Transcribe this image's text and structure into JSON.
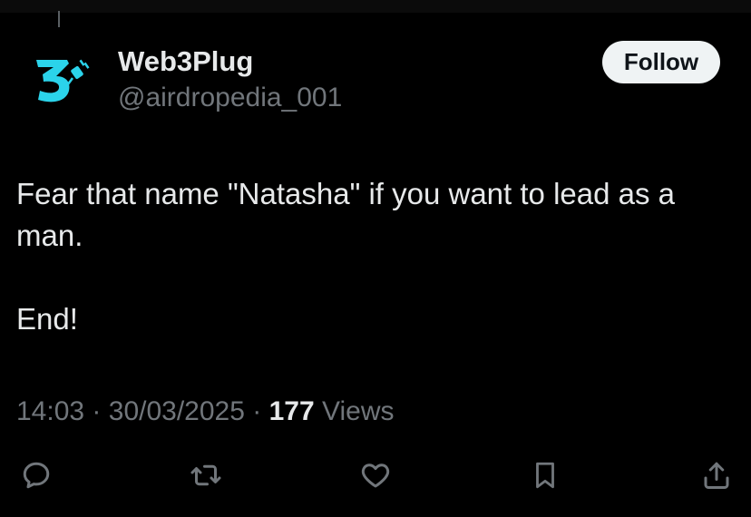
{
  "author": {
    "display_name": "Web3Plug",
    "handle": "@airdropedia_001",
    "avatar_icon": "web3plug-logo",
    "avatar_color": "#2bd3ea"
  },
  "follow_button": {
    "label": "Follow"
  },
  "tweet": {
    "lines": [
      "Fear that name \"Natasha\" if you want to lead as a man.",
      "End!"
    ]
  },
  "meta": {
    "time": "14:03",
    "separator": "·",
    "date": "30/03/2025",
    "views_count": "177",
    "views_label": "Views"
  },
  "actions": [
    {
      "name": "reply",
      "icon": "reply-icon"
    },
    {
      "name": "retweet",
      "icon": "retweet-icon"
    },
    {
      "name": "like",
      "icon": "heart-icon"
    },
    {
      "name": "bookmark",
      "icon": "bookmark-icon"
    },
    {
      "name": "share",
      "icon": "share-icon"
    }
  ],
  "colors": {
    "background": "#000000",
    "text_primary": "#e7e9ea",
    "text_secondary": "#71767b",
    "button_bg": "#eff3f4"
  }
}
